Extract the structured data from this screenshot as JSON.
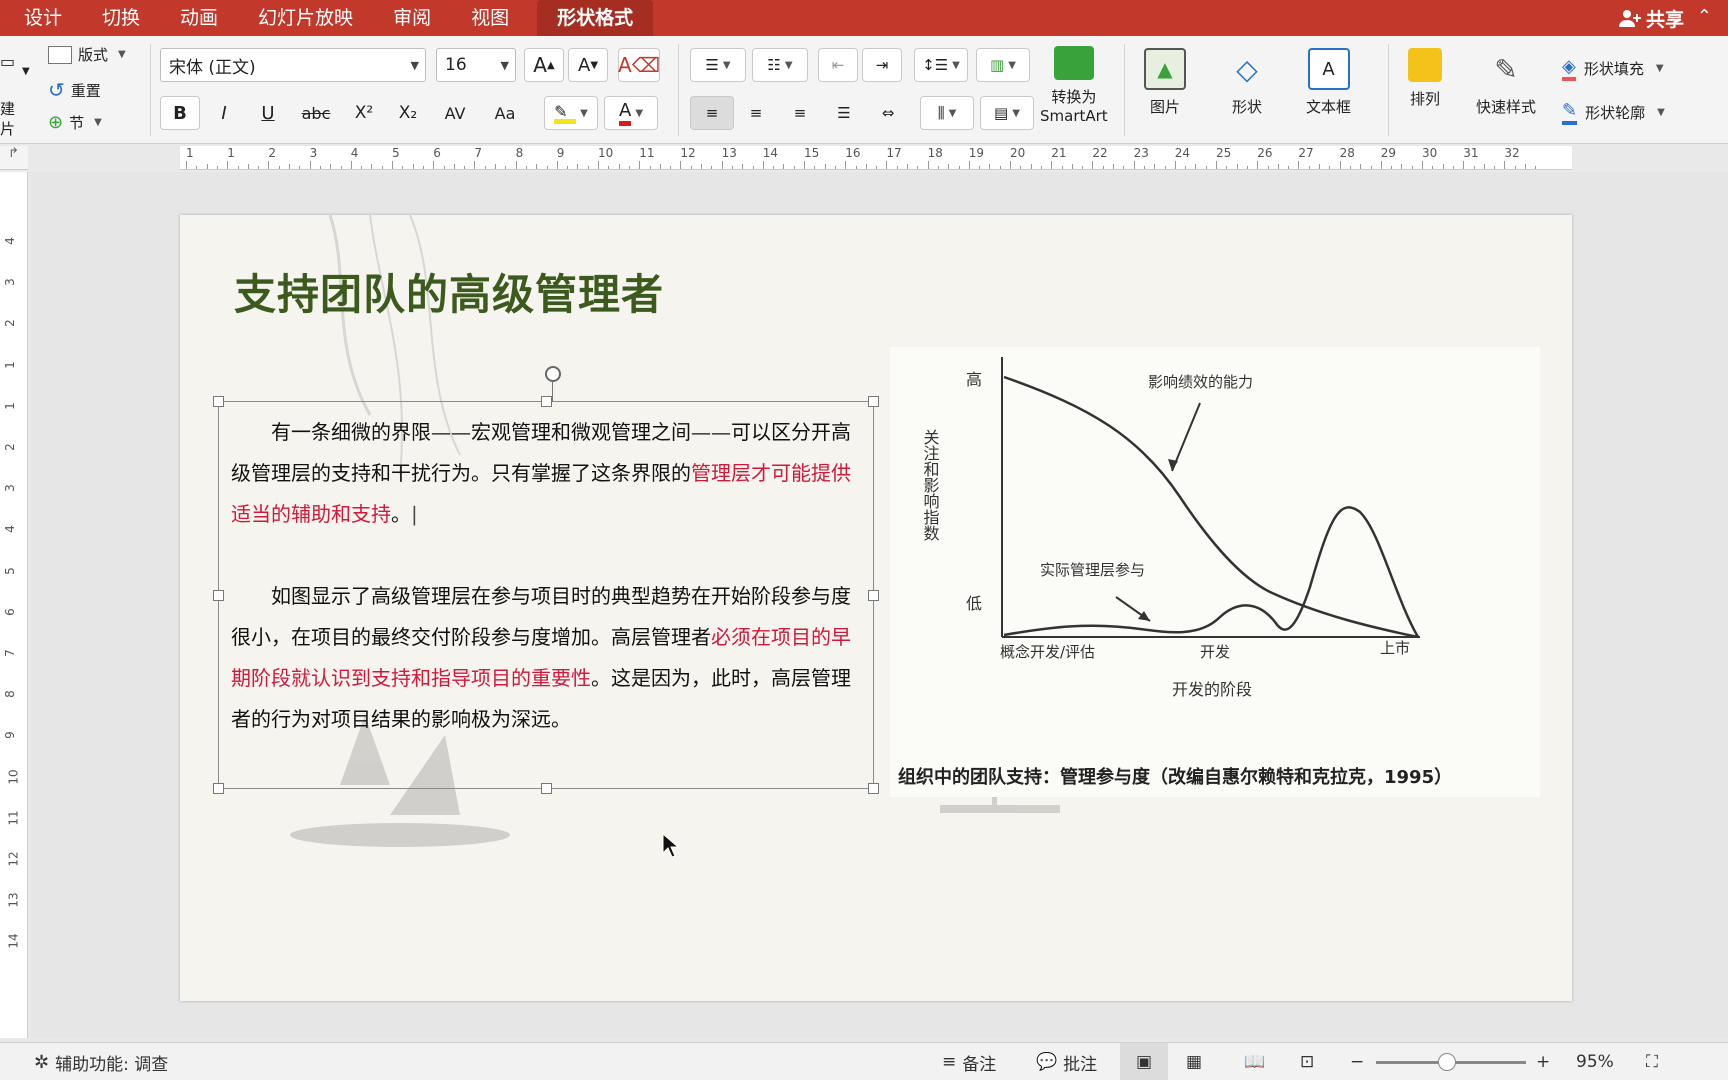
{
  "tabs": [
    "设计",
    "切换",
    "动画",
    "幻灯片放映",
    "审阅",
    "视图",
    "形状格式"
  ],
  "share_label": "共享",
  "ribbon": {
    "left_labels": {
      "new_slide_1": "建",
      "new_slide_2": "片",
      "layout": "版式",
      "reset": "重置",
      "section": "节"
    },
    "font_name": "宋体 (正文)",
    "font_size": "16",
    "format_buttons": [
      "B",
      "I",
      "U",
      "abc",
      "X²",
      "X₂",
      "AV",
      "Aa"
    ],
    "convert_label_1": "转换为",
    "convert_label_2": "SmartArt",
    "picture_label": "图片",
    "shape_label": "形状",
    "textbox_label": "文本框",
    "arrange_label": "排列",
    "quick_style_label": "快速样式",
    "shape_fill_label": "形状填充",
    "shape_outline_label": "形状轮廓"
  },
  "ruler": {
    "h_numbers": [
      "1",
      "1",
      "2",
      "3",
      "4",
      "5",
      "6",
      "7",
      "8",
      "9",
      "10",
      "11",
      "12",
      "13",
      "14",
      "15",
      "16",
      "17",
      "18",
      "19",
      "20",
      "21",
      "22",
      "23",
      "24",
      "25",
      "26",
      "27",
      "28",
      "29",
      "30",
      "31",
      "32"
    ],
    "v_numbers": [
      "4",
      "3",
      "2",
      "1",
      "1",
      "2",
      "3",
      "4",
      "5",
      "6",
      "7",
      "8",
      "9",
      "10",
      "11",
      "12",
      "13",
      "14"
    ]
  },
  "slide": {
    "title": "支持团队的高级管理者",
    "para1_a": "有一条细微的界限——宏观管理和微观管理之间——可以区分开高级管理层的支持和干扰行为。只有掌握了这条界限的",
    "para1_hl": "管理层才可能提供适当的辅助和支持",
    "para1_b": "。",
    "para2_a": "如图显示了高级管理层在参与项目时的典型趋势在开始阶段参与度很小，在项目的最终交付阶段参与度增加。高层管理者",
    "para2_hl": "必须在项目的早期阶段就认识到支持和指导项目的重要性",
    "para2_b": "。这是因为，此时，高层管理者的行为对项目结果的影响极为深远。",
    "caption": "组织中的团队支持：管理参与度（改编自惠尔赖特和克拉克，1995）"
  },
  "chart_data": {
    "type": "line",
    "ylabel": "关注和影响指数",
    "xlabel": "开发的阶段",
    "y_ticks": [
      "高",
      "低"
    ],
    "x_ticks": [
      "概念开发/评估",
      "开发",
      "上市"
    ],
    "series": [
      {
        "name": "影响绩效的能力",
        "trend": "high at start, declining steadily to low at launch"
      },
      {
        "name": "实际管理层参与",
        "trend": "low through early stages, small bump in development, peaks before launch then drops"
      }
    ]
  },
  "status": {
    "accessibility": "辅助功能: 调查",
    "notes": "备注",
    "comments": "批注",
    "zoom": "95%"
  },
  "colors": {
    "tab_bar": "#c2392c",
    "title_green": "#3d5a1e",
    "highlight_red": "#d0193b"
  }
}
